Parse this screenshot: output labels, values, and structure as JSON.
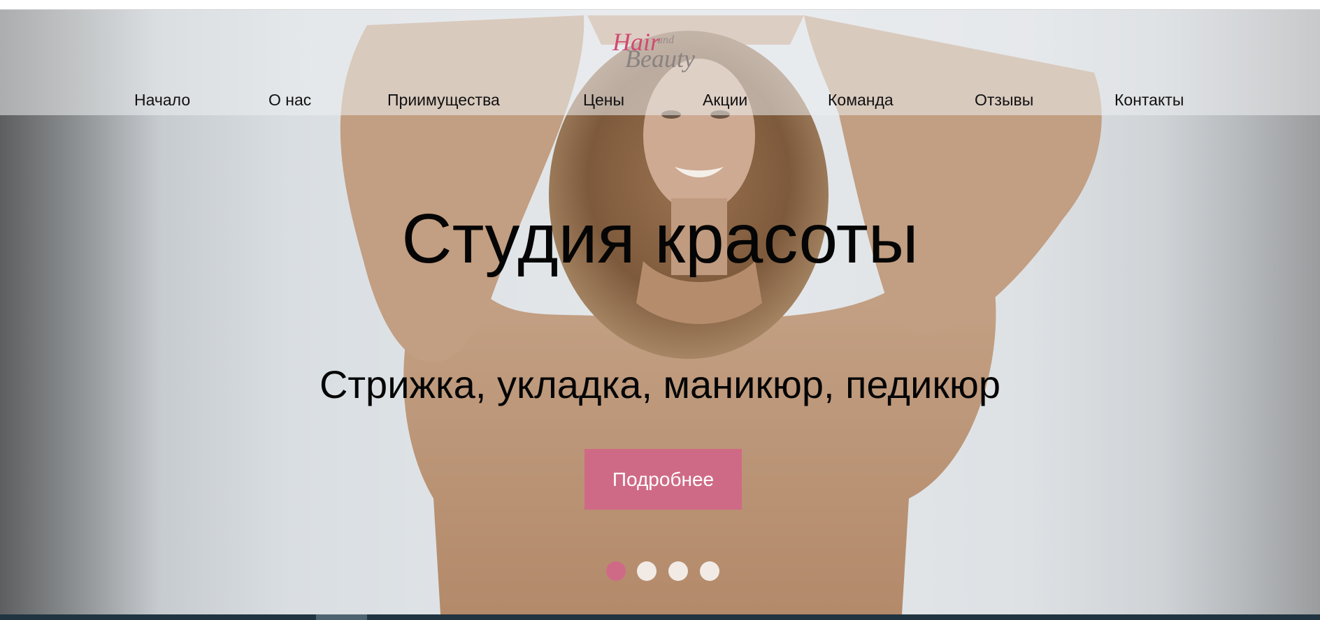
{
  "logo": {
    "line1": "Hair",
    "line2": "and",
    "line3": "Beauty"
  },
  "nav": {
    "items": [
      {
        "label": "Начало"
      },
      {
        "label": "О нас"
      },
      {
        "label": "Приимущества"
      },
      {
        "label": "Цены"
      },
      {
        "label": "Акции"
      },
      {
        "label": "Команда"
      },
      {
        "label": "Отзывы"
      },
      {
        "label": "Контакты"
      }
    ]
  },
  "hero": {
    "title": "Студия красоты",
    "subtitle": "Стрижка, укладка, маникюр, педикюр",
    "cta_label": "Подробнее"
  },
  "slider": {
    "count": 4,
    "active_index": 0
  },
  "colors": {
    "accent": "#cf6a86",
    "text": "#050505",
    "nav_text": "#111111",
    "footer_strip": "#1f3440"
  }
}
